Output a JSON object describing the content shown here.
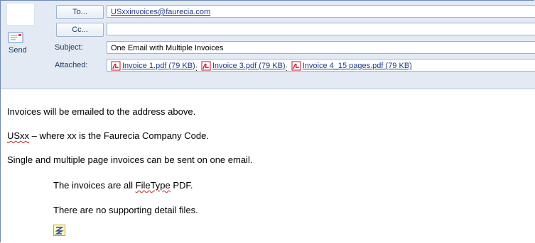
{
  "compose": {
    "send_label": "Send",
    "to_button": "To...",
    "cc_button": "Cc...",
    "subject_label": "Subject:",
    "attached_label": "Attached:",
    "to_value": "USxxinvoices@faurecia.com",
    "cc_value": "",
    "subject_value": "One Email with Multiple Invoices",
    "attachments": [
      {
        "name": "Invoice 1.pdf (79 KB)",
        "icon": "pdf-icon"
      },
      {
        "name": "Invoice 3.pdf (79 KB)",
        "icon": "pdf-icon"
      },
      {
        "name": "Invoice 4_15 pages.pdf (79 KB)",
        "icon": "pdf-icon"
      }
    ],
    "separator": ";"
  },
  "body": {
    "line1": "Invoices will be emailed to the address above.",
    "line2_code": "USxx",
    "line2_rest": " – where xx is the Faurecia Company Code.",
    "line3": "Single and multiple page invoices can be sent on one email.",
    "line4_start": "The invoices are all ",
    "line4_word": "FileType",
    "line4_end": " PDF.",
    "line5": "There are no supporting detail files."
  },
  "colors": {
    "header_bg": "#e3eaf4",
    "label_text": "#1e395b",
    "link": "#1f3a8a",
    "pdf_red": "#c8102e"
  }
}
